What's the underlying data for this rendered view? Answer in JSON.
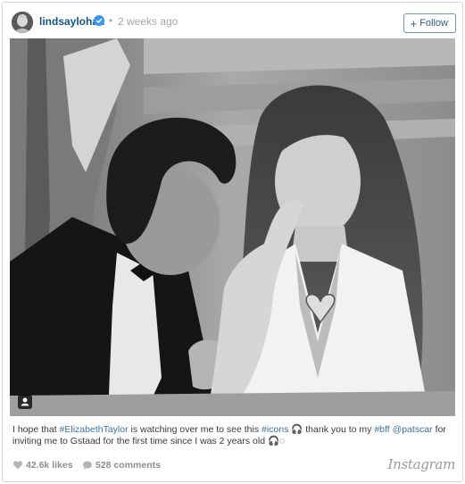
{
  "post": {
    "username": "lindsaylohan",
    "separator": "•",
    "timestamp": "2 weeks ago",
    "follow_label": "Follow",
    "follow_icon": "+",
    "photo_alt": "Black and white photo of a man in a tuxedo and a woman with long hair"
  },
  "caption": {
    "part1": "I hope that ",
    "tag1": "#ElizabethTaylor",
    "part2": " is watching over me to see this ",
    "tag2": "#icons",
    "part3": " 🎧 thank you to my ",
    "tag3": "#bff",
    "part4": " ",
    "tag4": "@patscar",
    "part5": " for inviting me to Gstaad for the first time since I was 2 years old 🎧◌"
  },
  "stats": {
    "likes": "42.6k likes",
    "comments": "528 comments"
  },
  "brand": "Instagram",
  "colors": {
    "username": "#125688",
    "hashtag": "#3f729b",
    "verified": "#3897f0",
    "follow_border": "#6f97b6"
  }
}
